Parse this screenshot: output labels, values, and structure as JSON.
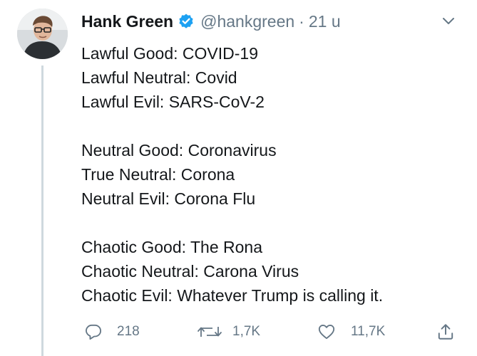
{
  "author": {
    "name": "Hank Green",
    "handle": "@hankgreen",
    "separator": "·",
    "time": "21 u",
    "verified": true,
    "avatar_icon": "profile-photo"
  },
  "body": {
    "lines": [
      "Lawful Good: COVID-19",
      "Lawful Neutral: Covid",
      "Lawful Evil: SARS-CoV-2",
      "",
      "Neutral Good: Coronavirus",
      "True Neutral: Corona",
      "Neutral Evil: Corona Flu",
      "",
      "Chaotic Good: The Rona",
      "Chaotic Neutral: Carona Virus",
      "Chaotic Evil: Whatever Trump is calling it."
    ]
  },
  "actions": {
    "reply": {
      "icon": "reply-icon",
      "count": "218"
    },
    "retweet": {
      "icon": "retweet-icon",
      "count": "1,7K"
    },
    "like": {
      "icon": "heart-icon",
      "count": "11,7K"
    },
    "share": {
      "icon": "share-icon"
    }
  },
  "colors": {
    "text": "#14171a",
    "secondary": "#657786",
    "verified_badge": "#1da1f2",
    "thread_line": "#cfd9de"
  }
}
